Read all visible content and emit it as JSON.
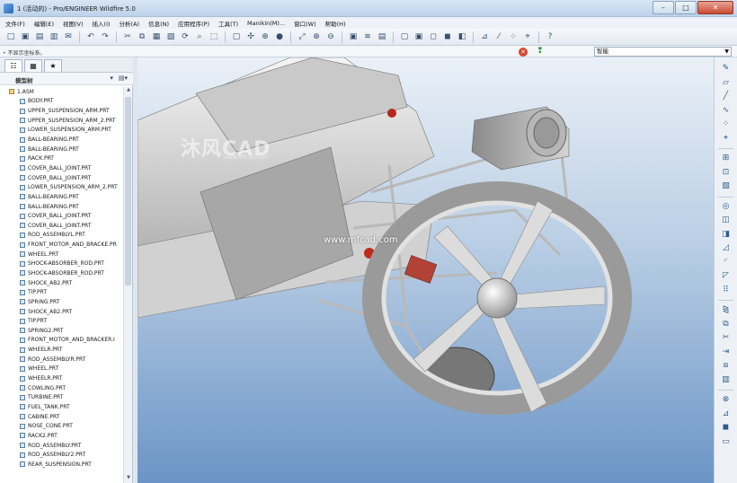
{
  "window": {
    "title": "1 (活动的) - Pro/ENGINEER Wildfire 5.0",
    "minimize": "–",
    "maximize": "□",
    "close": "✕"
  },
  "menu": [
    "文件(F)",
    "编辑(E)",
    "视图(V)",
    "插入(I)",
    "分析(A)",
    "信息(N)",
    "应用程序(P)",
    "工具(T)",
    "Manikin(M)...",
    "窗口(W)",
    "帮助(H)"
  ],
  "toolbar_icons": [
    "new-icon",
    "open-icon",
    "save-icon",
    "print-icon",
    "email-icon",
    "sep",
    "undo-icon",
    "redo-icon",
    "sep",
    "cut-icon",
    "copy-icon",
    "paste-icon",
    "paste-special-icon",
    "regenerate-icon",
    "find-icon",
    "select-box-icon",
    "sep",
    "repaint-icon",
    "spin-center-icon",
    "orient-icon",
    "appearance-icon",
    "sep",
    "refit-icon",
    "zoom-in-icon",
    "zoom-out-icon",
    "sep",
    "saved-views-icon",
    "layers-icon",
    "view-manager-icon",
    "sep",
    "wireframe-icon",
    "hidden-line-icon",
    "no-hidden-icon",
    "shading-icon",
    "enhanced-shading-icon",
    "sep",
    "datum-planes-icon",
    "datum-axes-icon",
    "datum-points-icon",
    "csys-icon",
    "sep",
    "help-icon"
  ],
  "toolbar_glyphs": {
    "new-icon": "□",
    "open-icon": "▣",
    "save-icon": "▤",
    "print-icon": "▥",
    "email-icon": "✉",
    "undo-icon": "↶",
    "redo-icon": "↷",
    "cut-icon": "✂",
    "copy-icon": "⧉",
    "paste-icon": "▦",
    "paste-special-icon": "▧",
    "regenerate-icon": "⟳",
    "find-icon": "⌕",
    "select-box-icon": "⬚",
    "repaint-icon": "▢",
    "spin-center-icon": "✣",
    "orient-icon": "⊕",
    "appearance-icon": "●",
    "refit-icon": "⤢",
    "zoom-in-icon": "⊕",
    "zoom-out-icon": "⊖",
    "saved-views-icon": "▣",
    "layers-icon": "≋",
    "view-manager-icon": "▤",
    "wireframe-icon": "▢",
    "hidden-line-icon": "▣",
    "no-hidden-icon": "◻",
    "shading-icon": "◼",
    "enhanced-shading-icon": "◧",
    "datum-planes-icon": "⊿",
    "datum-axes-icon": "⁄",
    "datum-points-icon": "⁘",
    "csys-icon": "⌖",
    "help-icon": "?"
  },
  "status": {
    "message": "不显示坐标系。",
    "filter": "智能"
  },
  "model_tree": {
    "label": "模型树",
    "tabs": [
      "model-tree-tab-icon",
      "folder-browser-tab-icon",
      "favorites-tab-icon"
    ],
    "tab_glyphs": [
      "☷",
      "▦",
      "★"
    ],
    "tools": [
      "▾",
      "▤▾"
    ],
    "root": "1.ASM",
    "items": [
      "BODY.PRT",
      "UPPER_SUSPENSION_ARM.PRT",
      "UPPER_SUSPENSION_ARM_2.PRT",
      "LOWER_SUSPENSION_ARM.PRT",
      "BALL-BEARING.PRT",
      "BALL-BEARING.PRT",
      "RACK.PRT",
      "COVER_BALL_JOINT.PRT",
      "COVER_BALL_JOINT.PRT",
      "LOWER_SUSPENSION_ARM_2.PRT",
      "BALL-BEARING.PRT",
      "BALL-BEARING.PRT",
      "COVER_BALL_JOINT.PRT",
      "COVER_BALL_JOINT.PRT",
      "ROD_ASSEMBLYL.PRT",
      "FRONT_MOTOR_AND_BRACKE.PR",
      "WHEEL.PRT",
      "SHOCK-ABSORBER_ROD.PRT",
      "SHOCK-ABSORBER_ROD.PRT",
      "SHOCK_AB2.PRT",
      "TIP.PRT",
      "SPRING.PRT",
      "SHOCK_AB2.PRT",
      "TIP.PRT",
      "SPRING2.PRT",
      "FRONT_MOTOR_AND_BRACKER.I",
      "WHEELR.PRT",
      "ROD_ASSEMBLYR.PRT",
      "WHEEL.PRT",
      "WHEELR.PRT",
      "COWLING.PRT",
      "TURBINE.PRT",
      "FUEL_TANK.PRT",
      "CABINE.PRT",
      "NOSE_CONE.PRT",
      "RACK2.PRT",
      "ROD_ASSEMBLY.PRT",
      "ROD_ASSEMBLY2.PRT",
      "REAR_SUSPENSION.PRT"
    ]
  },
  "viewport": {
    "watermark_logo": "沐风CAD",
    "watermark_sub": "www.mfcad.com",
    "watermark_url": "www.mfcad.com"
  },
  "right_toolbar": [
    {
      "name": "sketch-icon",
      "glyph": "✎"
    },
    {
      "name": "datum-plane-icon",
      "glyph": "▱"
    },
    {
      "name": "datum-axis-icon",
      "glyph": "╱"
    },
    {
      "name": "datum-curve-icon",
      "glyph": "∿"
    },
    {
      "name": "datum-point-icon",
      "glyph": "⁘"
    },
    {
      "name": "coordinate-system-icon",
      "glyph": "⌖"
    },
    {
      "name": "sep",
      "glyph": ""
    },
    {
      "name": "assemble-icon",
      "glyph": "⊞"
    },
    {
      "name": "create-component-icon",
      "glyph": "⊡"
    },
    {
      "name": "package-icon",
      "glyph": "▧"
    },
    {
      "name": "sep",
      "glyph": ""
    },
    {
      "name": "hole-icon",
      "glyph": "◎"
    },
    {
      "name": "shell-icon",
      "glyph": "◫"
    },
    {
      "name": "rib-icon",
      "glyph": "◨"
    },
    {
      "name": "draft-icon",
      "glyph": "◿"
    },
    {
      "name": "round-icon",
      "glyph": "◜"
    },
    {
      "name": "chamfer-icon",
      "glyph": "◸"
    },
    {
      "name": "pattern-icon",
      "glyph": "⠿"
    },
    {
      "name": "sep",
      "glyph": ""
    },
    {
      "name": "mirror-icon",
      "glyph": "⧎"
    },
    {
      "name": "merge-icon",
      "glyph": "⧉"
    },
    {
      "name": "trim-icon",
      "glyph": "✂"
    },
    {
      "name": "extend-icon",
      "glyph": "⇥"
    },
    {
      "name": "offset-icon",
      "glyph": "⧈"
    },
    {
      "name": "thicken-icon",
      "glyph": "▥"
    },
    {
      "name": "sep",
      "glyph": ""
    },
    {
      "name": "intersect-icon",
      "glyph": "⊗"
    },
    {
      "name": "project-icon",
      "glyph": "⊿"
    },
    {
      "name": "solidify-icon",
      "glyph": "◼"
    },
    {
      "name": "flex-icon",
      "glyph": "▭"
    }
  ]
}
